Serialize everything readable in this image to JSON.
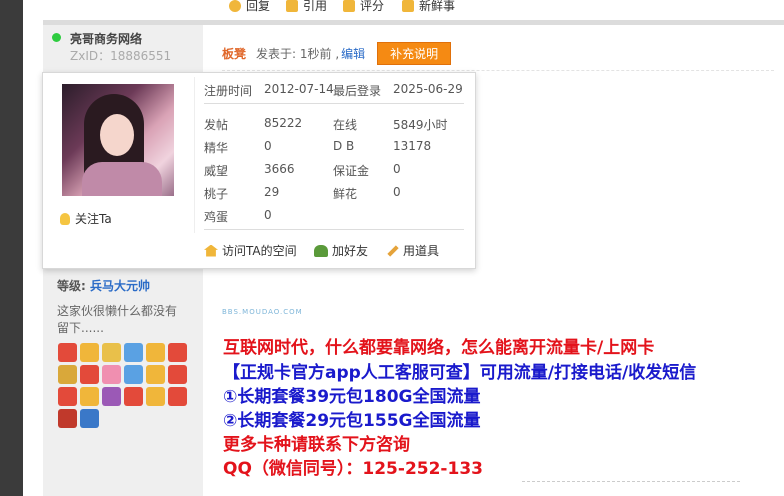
{
  "actions": [
    {
      "label": "回复",
      "color": "#f0b63a"
    },
    {
      "label": "引用",
      "color": "#f0b63a"
    },
    {
      "label": "评分",
      "color": "#f0b63a"
    },
    {
      "label": "新鲜事",
      "color": "#f0b63a"
    }
  ],
  "user": {
    "name": "亮哥商务网络",
    "zxid": "ZxID：18886551",
    "status_color": "#2ecc40"
  },
  "post": {
    "floor": "板凳",
    "posted": "发表于: 1秒前 ,",
    "edit": "编辑",
    "supplement": "补充说明"
  },
  "card": {
    "reg_label": "注册时间",
    "reg_date": "2012-07-14",
    "last_label": "最后登录",
    "last_date": "2025-06-29",
    "stats_left": [
      {
        "label": "发帖",
        "value": "85222"
      },
      {
        "label": "精华",
        "value": "0"
      },
      {
        "label": "威望",
        "value": "3666"
      },
      {
        "label": "桃子",
        "value": "29"
      },
      {
        "label": "鸡蛋",
        "value": "0"
      }
    ],
    "stats_right": [
      {
        "label": "在线",
        "value": "5849小时"
      },
      {
        "label": "D B",
        "value": "13178"
      },
      {
        "label": "保证金",
        "value": "0"
      },
      {
        "label": "鲜花",
        "value": "0"
      }
    ],
    "follow": "关注Ta",
    "visit": "访问TA的空间",
    "add_friend": "加好友",
    "use_item": "用道具"
  },
  "level": {
    "label": "等级:",
    "value": "兵马大元帅"
  },
  "signature": "这家伙很懒什么都没有留下......",
  "watermark": "BBS.MOUDAO.COM",
  "ad_lines": [
    {
      "text": "互联网时代，什么都要靠网络，怎么能离开流量卡/上网卡",
      "color": "red"
    },
    {
      "text": "【正规卡官方app人工客服可查】可用流量/打接电话/收发短信",
      "color": "blue"
    },
    {
      "text": "①长期套餐39元包180G全国流量",
      "color": "blue"
    },
    {
      "text": "②长期套餐29元包155G全国流量",
      "color": "blue"
    },
    {
      "text": "更多卡种请联系下方咨询",
      "color": "red"
    },
    {
      "text": "QQ（微信同号）：125-252-133",
      "color": "red"
    }
  ],
  "medal_colors": [
    "#e34a3a",
    "#f0b63a",
    "#e9c04a",
    "#5aa1e3",
    "#f0b63a",
    "#e34a3a",
    "#d9a83a",
    "#e34a3a",
    "#f08fb0",
    "#5aa1e3",
    "#f0b63a",
    "#e34a3a",
    "#e34a3a",
    "#f0b63a",
    "#9b59b6",
    "#e34a3a",
    "#f0b63a",
    "#e34a3a",
    "#c0392b",
    "#3a78c8"
  ]
}
